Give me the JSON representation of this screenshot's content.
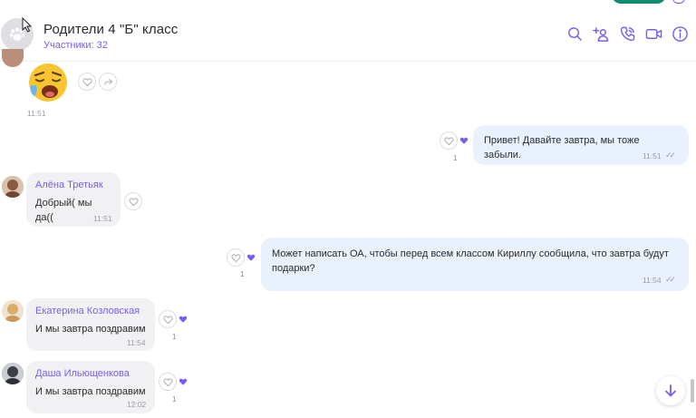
{
  "header": {
    "title": "Родители 4 \"Б\" класс",
    "subtitle": "Участники: 32",
    "icons": [
      "search-icon",
      "add-participant-icon",
      "call-icon",
      "video-call-icon",
      "info-icon"
    ]
  },
  "colors": {
    "accent": "#7360f2",
    "incoming": "#f1f1f4",
    "outgoing": "#e9f1fc"
  },
  "messages": [
    {
      "type": "sticker",
      "sticker": "crying-face-emoji",
      "time": "11:51"
    },
    {
      "type": "outgoing",
      "text": "Привет! Давайте завтра, мы тоже забыли.",
      "time": "11:51",
      "likes": "1"
    },
    {
      "type": "incoming",
      "sender": "Алёна Третьяк",
      "text": "Добрый( мы да((",
      "time": "11:51"
    },
    {
      "type": "outgoing",
      "text": "Может написать ОА, чтобы перед всем классом Кириллу сообщила, что завтра  будут подарки?",
      "time": "11:54",
      "likes": "1"
    },
    {
      "type": "incoming",
      "sender": "Екатерина Козловская",
      "text": "И мы завтра поздравим",
      "time": "11:54",
      "likes": "1"
    },
    {
      "type": "incoming",
      "sender": "Даша Ильющенкова",
      "text": "И мы завтра поздравим",
      "time": "12:02",
      "likes": "1"
    }
  ]
}
